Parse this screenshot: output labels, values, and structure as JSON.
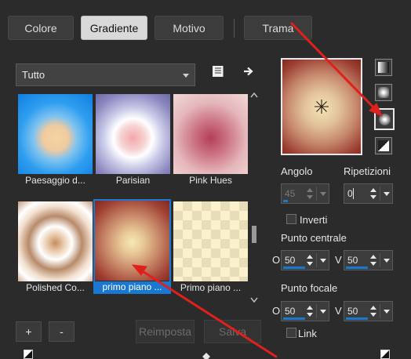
{
  "tabs": [
    {
      "label": "Colore",
      "active": false
    },
    {
      "label": "Gradiente",
      "active": true
    },
    {
      "label": "Motivo",
      "active": false
    },
    {
      "label": "Trama",
      "active": false
    }
  ],
  "category_select": {
    "value": "Tutto"
  },
  "toolbar_icons": [
    "document-list-icon",
    "arrow-right-icon"
  ],
  "gradients": [
    {
      "caption": "Paesaggio d...",
      "selected": false
    },
    {
      "caption": "Parisian",
      "selected": false
    },
    {
      "caption": "Pink Hues",
      "selected": false
    },
    {
      "caption": "Polished Co...",
      "selected": false
    },
    {
      "caption": "primo piano ...",
      "selected": true
    },
    {
      "caption": "Primo piano ...",
      "selected": false
    }
  ],
  "bottom_buttons": {
    "add": "+",
    "remove": "-",
    "reset": "Reimposta",
    "save": "Salva"
  },
  "style_buttons": [
    "linear-style-icon",
    "rectangular-style-icon",
    "radial-style-icon",
    "sunburst-style-icon"
  ],
  "angle": {
    "label": "Angolo",
    "value": "45",
    "enabled": false
  },
  "repeats": {
    "label": "Ripetizioni",
    "value": "0"
  },
  "invert": {
    "label": "Inverti",
    "checked": false
  },
  "center_point": {
    "label": "Punto centrale",
    "o_label": "O",
    "v_label": "V",
    "o_value": "50",
    "v_value": "50"
  },
  "focal_point": {
    "label": "Punto focale",
    "o_label": "O",
    "v_label": "V",
    "o_value": "50",
    "v_value": "50"
  },
  "link": {
    "label": "Link",
    "checked": false
  },
  "colors": {
    "accent": "#1b78d0",
    "annotation_arrow": "#e0201c",
    "background": "#2b2b2b"
  }
}
